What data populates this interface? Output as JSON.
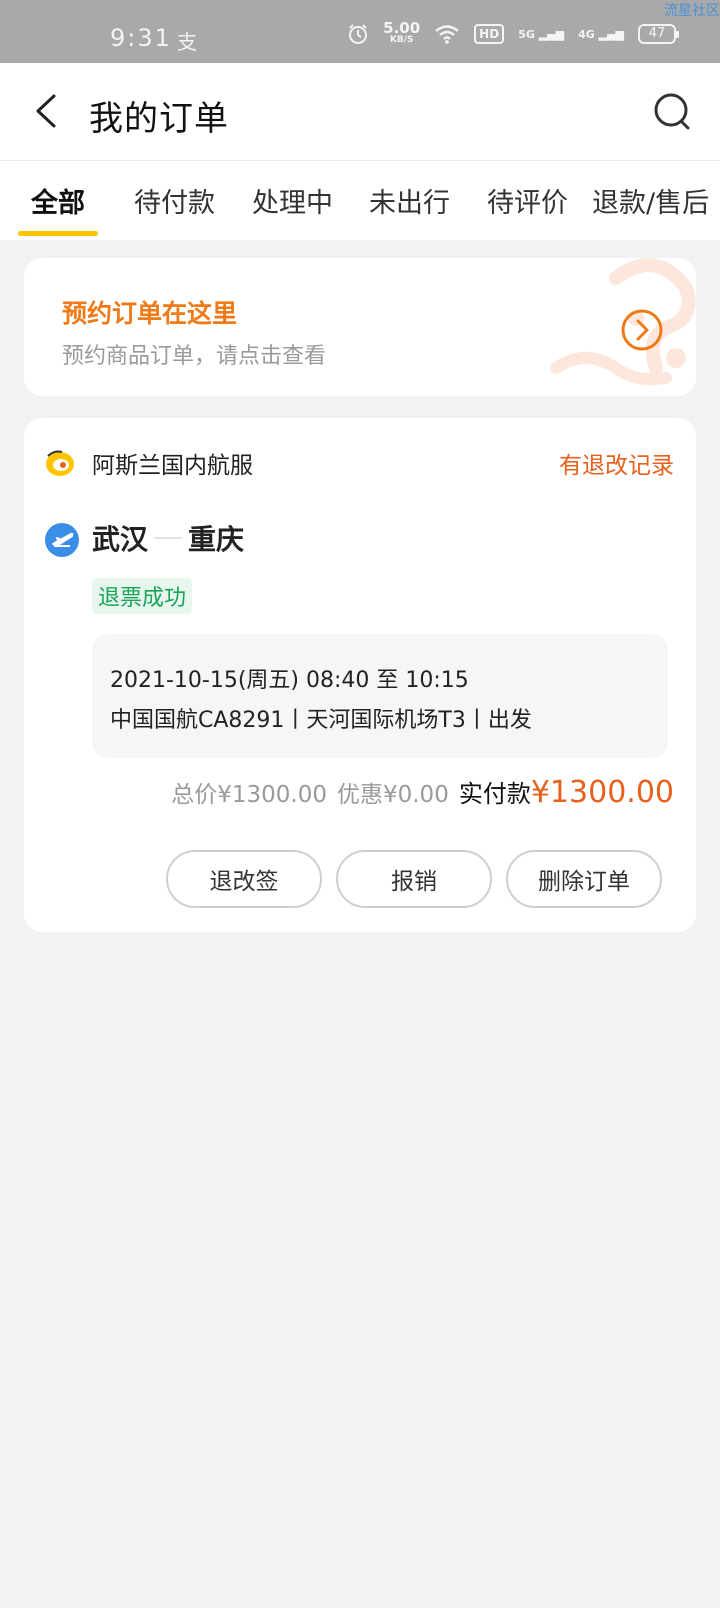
{
  "status_bar": {
    "time": "9:31",
    "app_glyph": "支",
    "net_speed": "5.00",
    "net_unit": "KB/S",
    "hd": "HD",
    "signal1": "5G",
    "signal2": "4G",
    "battery": "47",
    "watermark": "流星社区"
  },
  "header": {
    "title": "我的订单",
    "back_icon": "chevron-left-icon",
    "search_icon": "search-icon"
  },
  "tabs": [
    {
      "label": "全部",
      "active": true
    },
    {
      "label": "待付款"
    },
    {
      "label": "处理中"
    },
    {
      "label": "未出行"
    },
    {
      "label": "待评价"
    },
    {
      "label": "退款/售后"
    }
  ],
  "promo": {
    "title": "预约订单在这里",
    "subtitle": "预约商品订单，请点击查看",
    "arrow_icon": "chevron-right-circle-icon"
  },
  "order": {
    "shop_name": "阿斯兰国内航服",
    "refund_record": "有退改记录",
    "from": "武汉",
    "to": "重庆",
    "status": "退票成功",
    "flight_time": "2021-10-15(周五) 08:40 至 10:15",
    "flight_detail": "中国国航CA8291丨天河国际机场T3丨出发",
    "total": "总价¥1300.00",
    "discount": "优惠¥0.00",
    "paid_label": "实付款",
    "paid": "¥1300.00",
    "buttons": [
      "退改签",
      "报销",
      "删除订单"
    ]
  },
  "colors": {
    "accent_orange": "#f07a18",
    "price_orange": "#e8601c",
    "tab_underline": "#ffc300",
    "status_green": "#1aa35a"
  }
}
